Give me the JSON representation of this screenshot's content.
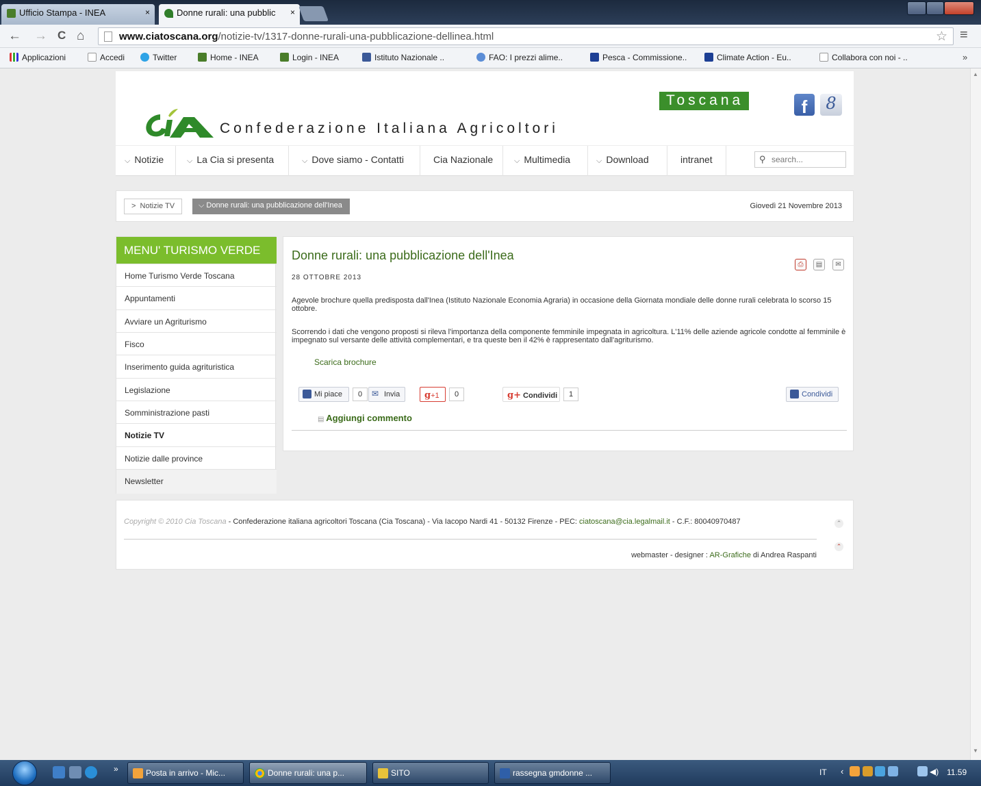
{
  "browser": {
    "tabs": [
      {
        "title": "Ufficio Stampa - INEA",
        "close": "×"
      },
      {
        "title": "Donne rurali: una pubblic",
        "close": "×"
      }
    ],
    "nav": {
      "back": "←",
      "forward": "→",
      "reload": "C",
      "home": "⌂"
    },
    "url": {
      "domain": "www.ciatoscana.org",
      "path": "/notizie-tv/1317-donne-rurali-una-pubblicazione-dellinea.html"
    },
    "star_icon": "☆",
    "menu_icon": "≡",
    "bookmarks": [
      "Applicazioni",
      "Accedi",
      "Twitter",
      "Home - INEA",
      "Login - INEA",
      "Istituto Nazionale ..",
      "FAO: I prezzi alime..",
      "Pesca - Commissione..",
      "Climate Action - Eu..",
      "Collabora con noi - .."
    ],
    "bookmarks_more": "»"
  },
  "site": {
    "org_name": "Confederazione Italiana Agricoltori",
    "region": "Toscana",
    "facebook_glyph": "f",
    "gplus_glyph": "8",
    "nav": {
      "items": [
        "Notizie",
        "La Cia si presenta",
        "Dove siamo - Contatti",
        "Cia Nazionale",
        "Multimedia",
        "Download",
        "intranet"
      ],
      "search_placeholder": "search..."
    },
    "breadcrumb": {
      "section": "Notizie TV",
      "current": "Donne rurali: una pubblicazione dell'Inea",
      "date": "Giovedì 21 Novembre 2013"
    },
    "sidebar": {
      "title": "MENU' TURISMO VERDE",
      "items": [
        "Home Turismo Verde Toscana",
        "Appuntamenti",
        "Avviare un Agriturismo",
        "Fisco",
        "Inserimento guida agrituristica",
        "Legislazione",
        "Somministrazione pasti",
        "Notizie TV",
        "Notizie dalle province",
        "Newsletter"
      ]
    },
    "article": {
      "title": "Donne rurali: una pubblicazione dell'Inea",
      "date": "28 OTTOBRE 2013",
      "paragraphs": [
        "Agevole brochure quella predisposta dall'Inea (Istituto Nazionale Economia Agraria) in occasione della Giornata mondiale delle donne rurali celebrata lo scorso 15 ottobre.",
        "Scorrendo i dati che vengono proposti si rileva l'importanza della componente femminile impegnata in agricoltura. L'11% delle aziende agricole condotte al femminile è impegnato sul versante delle attività complementari, e tra queste ben il 42% è rappresentato dall'agriturismo."
      ],
      "download_link": "Scarica brochure",
      "share": {
        "fb_like": "Mi piace",
        "fb_like_count": "0",
        "fb_send": "Invia",
        "gplus_one": "+1",
        "gplus_one_count": "0",
        "gplus_share": "Condividi",
        "gplus_share_count": "1",
        "fb_share": "Condividi"
      },
      "add_comment": "Aggiungi commento"
    },
    "footer": {
      "copyright": "Copyright © 2010 Cia Toscana",
      "info": " - Confederazione italiana agricoltori Toscana (Cia Toscana) - Via Iacopo Nardi 41 - 50132 Firenze -  PEC: ",
      "pec": "ciatoscana@cia.legalmail.it",
      "cf": " -  C.F.: 80040970487",
      "credits_prefix": "webmaster - designer : ",
      "credits_link": "AR-Grafiche",
      "credits_suffix": " di Andrea Raspanti"
    }
  },
  "taskbar": {
    "more": "»",
    "tasks": [
      "Posta in arrivo - Mic...",
      "Donne rurali: una p...",
      "SITO",
      "rassegna gmdonne ..."
    ],
    "lang": "IT",
    "time": "11.59"
  }
}
